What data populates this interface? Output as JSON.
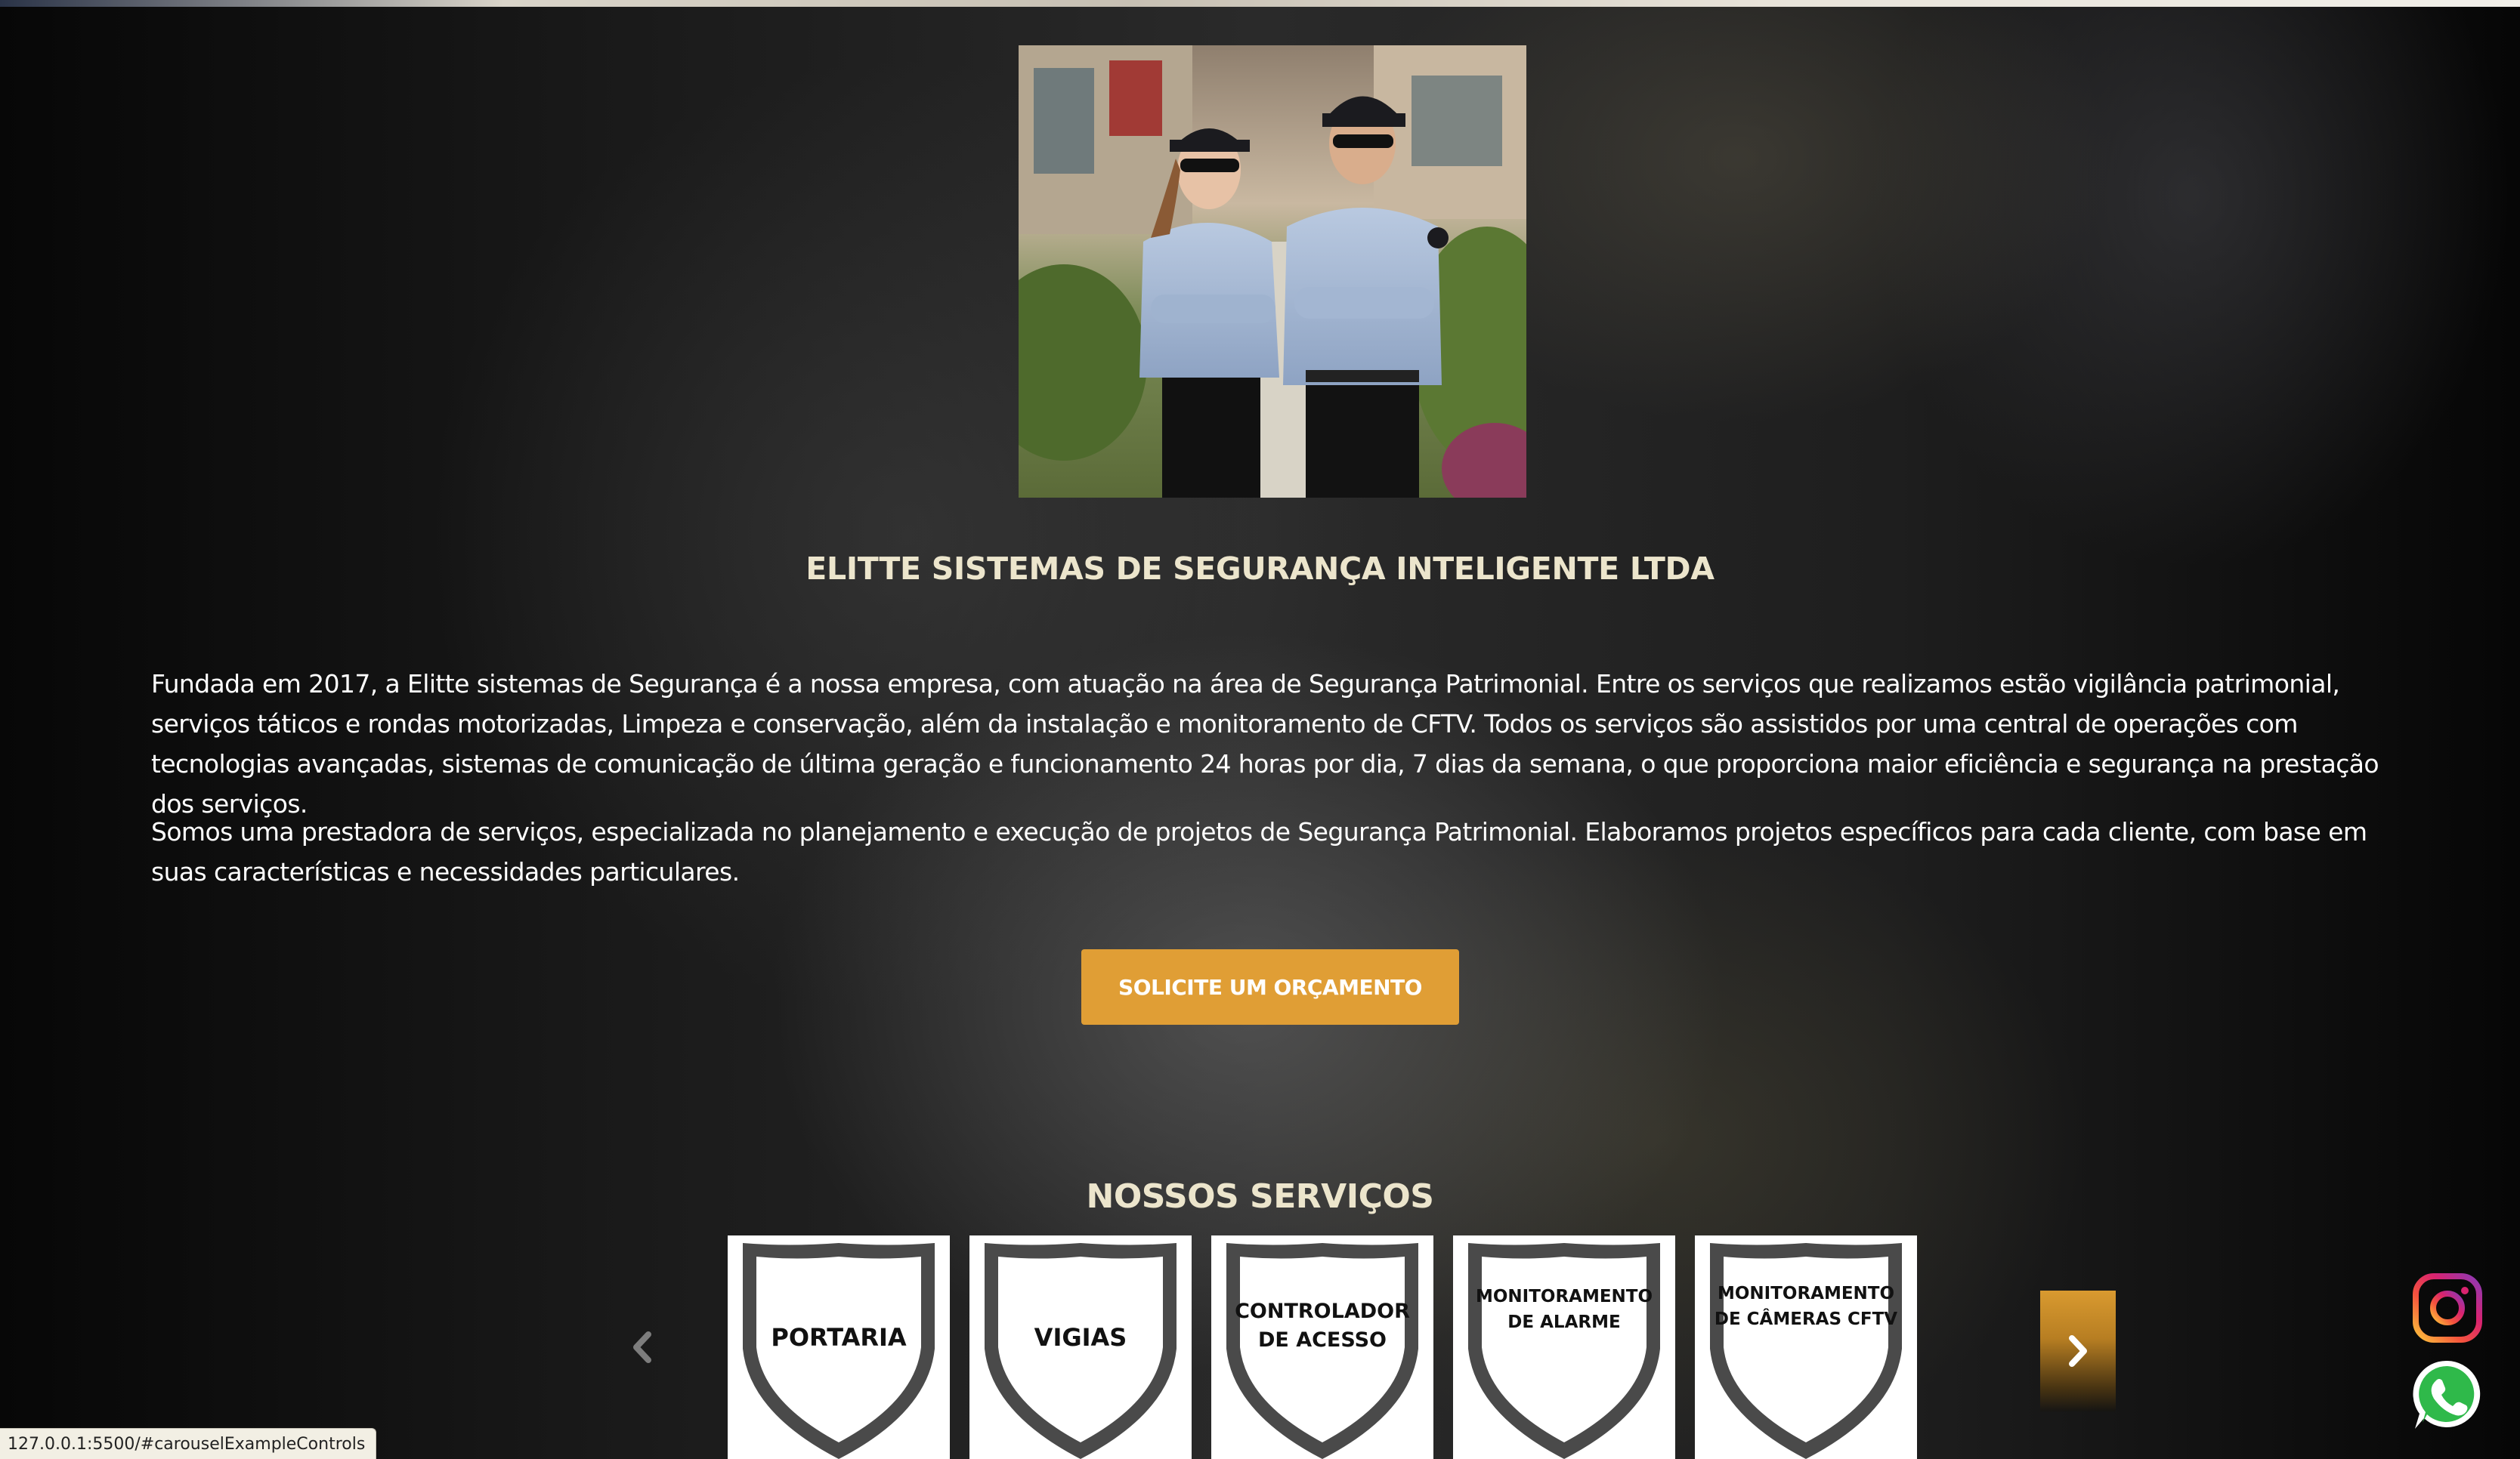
{
  "company": {
    "title": "ELITTE SISTEMAS DE SEGURANÇA INTELIGENTE LTDA"
  },
  "about": {
    "paragraph_1": "Fundada em 2017, a Elitte sistemas de Segurança é a nossa empresa, com atuação na área de Segurança Patrimonial. Entre os serviços que realizamos estão vigilância patrimonial, serviços táticos e rondas motorizadas, Limpeza e conservação, além da instalação e monitoramento de CFTV. Todos os serviços são assistidos por uma central de operações com tecnologias avançadas, sistemas de comunicação de última geração e funcionamento 24 horas por dia, 7 dias da semana, o que proporciona maior eficiência e segurança na prestação dos serviços.",
    "paragraph_2": "Somos uma prestadora de serviços, especializada no planejamento e execução de projetos de Segurança Patrimonial. Elaboramos projetos específicos para cada cliente, com base em suas características e necessidades particulares."
  },
  "cta": {
    "quote_label": "SOLICITE UM ORÇAMENTO"
  },
  "services": {
    "title": "NOSSOS SERVIÇOS",
    "items": [
      {
        "line1": "PORTARIA",
        "line2": ""
      },
      {
        "line1": "VIGIAS",
        "line2": ""
      },
      {
        "line1": "CONTROLADOR",
        "line2": "DE ACESSO"
      },
      {
        "line1": "MONITORAMENTO",
        "line2": "DE ALARME"
      },
      {
        "line1": "MONITORAMENTO",
        "line2": "DE CÂMERAS CFTV"
      }
    ]
  },
  "carousel": {
    "prev_icon": "chevron-left-icon",
    "next_icon": "chevron-right-icon"
  },
  "social": {
    "instagram_icon": "instagram-icon",
    "whatsapp_icon": "whatsapp-icon"
  },
  "status_bar": {
    "url": "127.0.0.1:5500/#carouselExampleControls"
  },
  "colors": {
    "accent": "#e09e35",
    "heading": "#ece5cc",
    "body_text": "#ffffff"
  }
}
